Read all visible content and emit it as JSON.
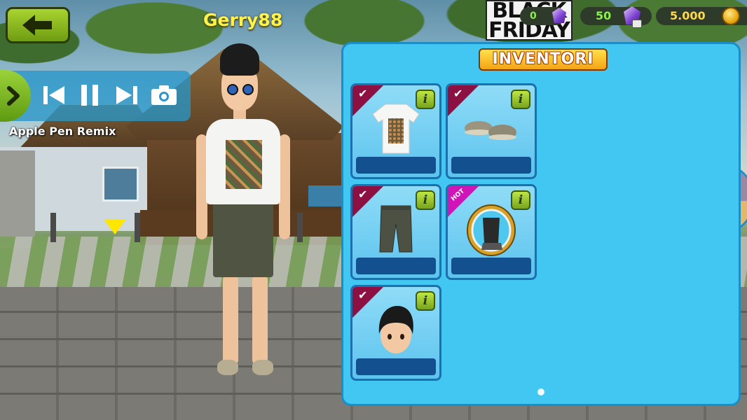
{
  "player": {
    "name": "Gerry88"
  },
  "music": {
    "song_title": "Apple Pen Remix"
  },
  "promo": {
    "line1": "BLACK",
    "line2": "FRIDAY",
    "badge_value": "0"
  },
  "currency": {
    "gems": "50",
    "coins": "5.000"
  },
  "inventory": {
    "title": "INVENTORI",
    "info_label": "i",
    "items": [
      {
        "badge": "check",
        "badge_text": "✔",
        "icon": "tshirt-icon"
      },
      {
        "badge": "check",
        "badge_text": "✔",
        "icon": "sneakers-icon"
      },
      {
        "badge": "check",
        "badge_text": "✔",
        "icon": "shorts-icon"
      },
      {
        "badge": "hot",
        "badge_text": "HOT",
        "icon": "hoverboard-icon"
      },
      {
        "badge": "check",
        "badge_text": "✔",
        "icon": "hair-icon"
      }
    ]
  },
  "colors": {
    "panel": "#41c7f1",
    "title_bg": "#f5a315",
    "check_badge": "#8c1042",
    "hot_badge": "#d014b8",
    "button_green": "#8bbf22"
  }
}
